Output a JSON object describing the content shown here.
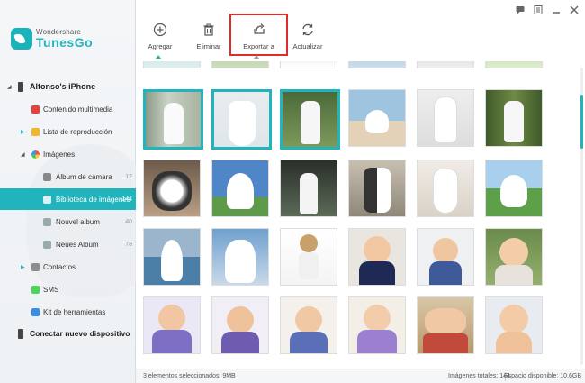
{
  "app": {
    "logo_sub": "Wondershare",
    "logo_main": "TunesGo"
  },
  "toolbar": {
    "add_label": "Agregar",
    "delete_label": "Eliminar",
    "export_label": "Exportar a",
    "refresh_label": "Actualizar"
  },
  "sidebar": {
    "device_name": "Alfonso's iPhone",
    "items": [
      {
        "label": "Contenido multimedia",
        "count": ""
      },
      {
        "label": "Lista de reproducción",
        "count": ""
      },
      {
        "label": "Imágenes",
        "count": ""
      },
      {
        "label": "Álbum de cámara",
        "count": "12"
      },
      {
        "label": "Biblioteca de imágenes",
        "count": "144"
      },
      {
        "label": "Nouvel album",
        "count": "40"
      },
      {
        "label": "Neues Album",
        "count": "78"
      },
      {
        "label": "Contactos",
        "count": ""
      },
      {
        "label": "SMS",
        "count": ""
      },
      {
        "label": "Kit de herramientas",
        "count": ""
      }
    ],
    "connect_label": "Conectar nuevo dispositivo"
  },
  "status": {
    "selection": "3 elementos seleccionados, 9MB",
    "total": "Imágenes totales: 144",
    "space": "Espacio disponible: 10.6GB"
  },
  "colors": {
    "accent": "#22b4bd",
    "highlight_box": "#e02b2b"
  }
}
